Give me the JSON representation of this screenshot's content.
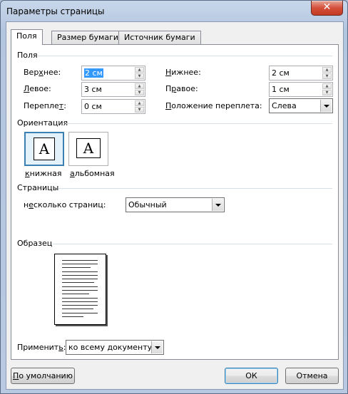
{
  "window": {
    "title": "Параметры страницы",
    "close_symbol": "✕"
  },
  "tabs": [
    "Поля",
    "Размер бумаги",
    "Источник бумаги"
  ],
  "margins": {
    "section": "Поля",
    "top": {
      "label_pre": "Вер",
      "label_u": "х",
      "label_post": "нее:",
      "value": "2 см"
    },
    "left": {
      "label_pre": "",
      "label_u": "Л",
      "label_post": "евое:",
      "value": "3 см"
    },
    "gutter": {
      "label_pre": "Перепле",
      "label_u": "т",
      "label_post": ":",
      "value": "0 см"
    },
    "bottom": {
      "label_pre": "",
      "label_u": "Н",
      "label_post": "ижнее:",
      "value": "2 см"
    },
    "right": {
      "label_pre": "П",
      "label_u": "р",
      "label_post": "авое:",
      "value": "1 см"
    },
    "gutter_pos": {
      "label_pre": "",
      "label_u": "П",
      "label_post": "оложение переплета:",
      "value": "Слева"
    }
  },
  "orientation": {
    "section": "Ориентация",
    "portrait_pre": "",
    "portrait_u": "к",
    "portrait_post": "нижная",
    "landscape_pre": "",
    "landscape_u": "а",
    "landscape_post": "льбомная",
    "icon_letter": "A"
  },
  "pages": {
    "section": "Страницы",
    "multiple_pre": "н",
    "multiple_u": "е",
    "multiple_post": "сколько страниц:",
    "value": "Обычный"
  },
  "sample": {
    "section": "Образец"
  },
  "apply": {
    "label_pre": "Применит",
    "label_u": "ь",
    "label_post": ":",
    "value": "ко всему документу"
  },
  "buttons": {
    "default_pre": "",
    "default_u": "П",
    "default_post": "о умолчанию",
    "ok": "ОК",
    "cancel": "Отмена"
  },
  "colors": {
    "accent": "#3399ff",
    "title_bg": "#b9cbe3",
    "close_bg": "#c74a33"
  }
}
